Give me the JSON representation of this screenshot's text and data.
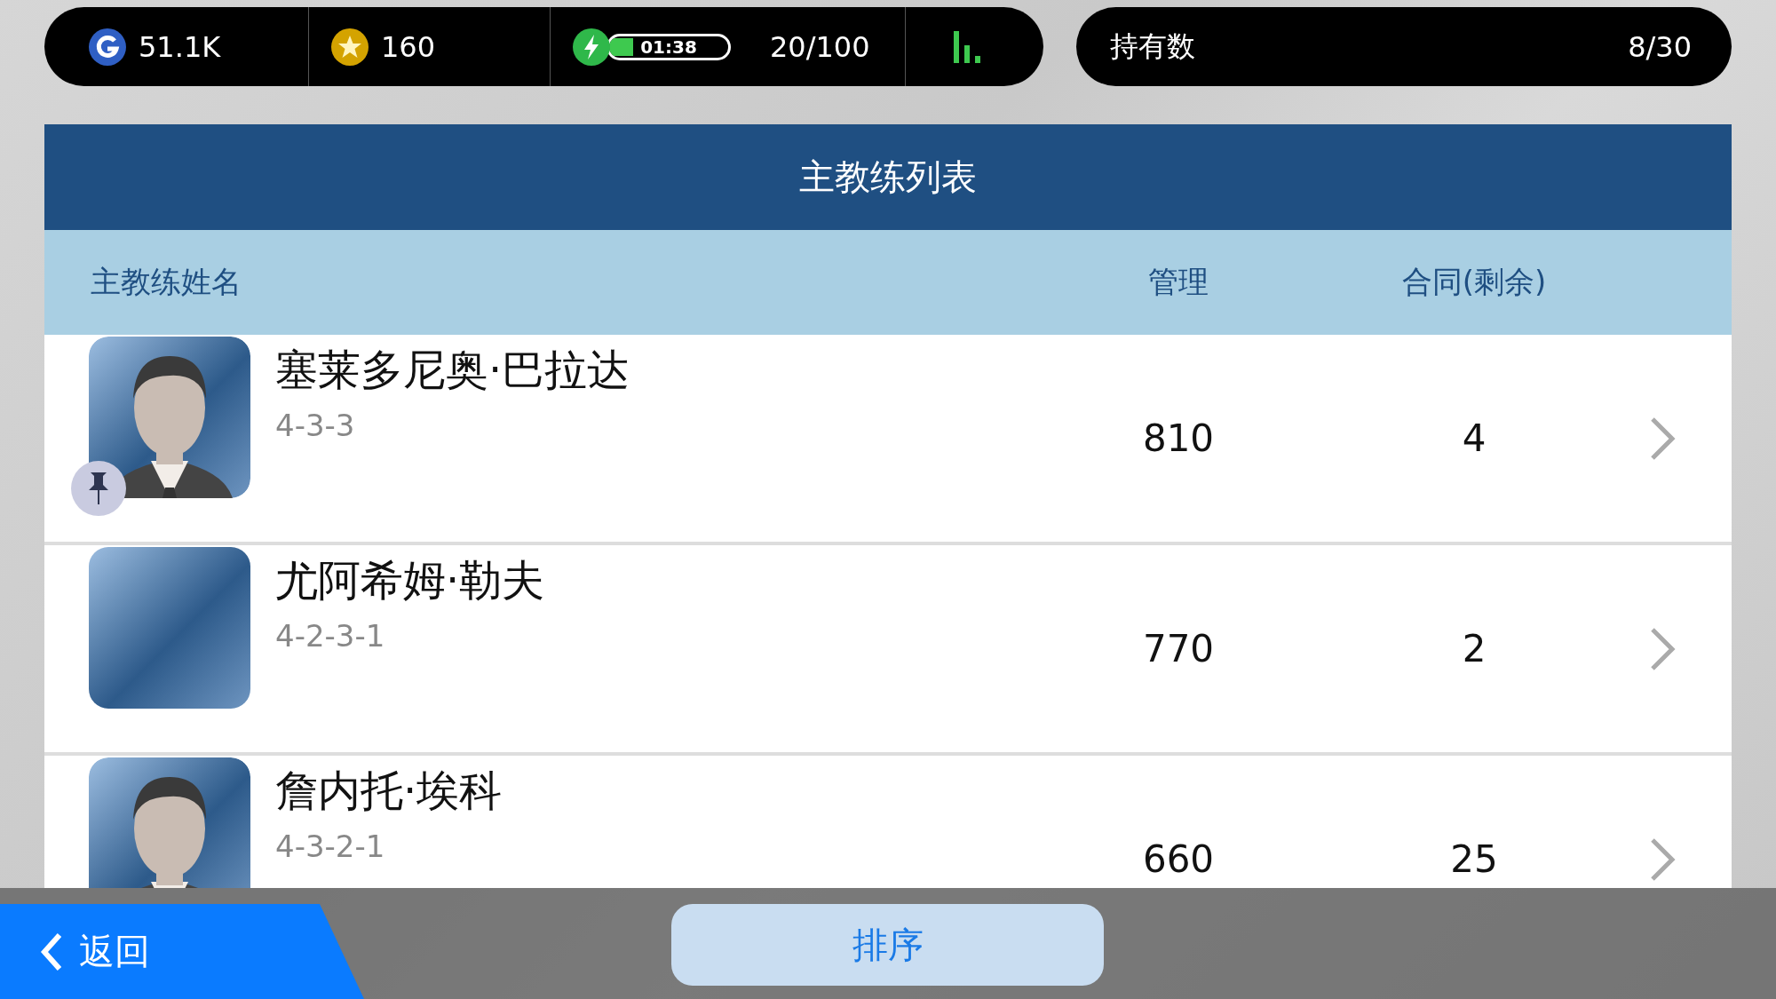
{
  "status_bar": {
    "gp": "51.1K",
    "coins": "160",
    "energy": {
      "timer": "01:38",
      "level": 0.2,
      "count": "20/100"
    }
  },
  "holdings": {
    "label": "持有数",
    "value": "8/30"
  },
  "panel": {
    "title": "主教练列表",
    "columns": [
      "主教练姓名",
      "管理",
      "合同(剩余)"
    ],
    "rows": [
      {
        "name": "塞莱多尼奥·巴拉达",
        "formation": "4-3-3",
        "management": "810",
        "contract": "4",
        "kind": "silhouette",
        "pinned": true
      },
      {
        "name": "尤阿希姆·勒夫",
        "formation": "4-2-3-1",
        "management": "770",
        "contract": "2",
        "kind": "photo",
        "pinned": false
      },
      {
        "name": "詹内托·埃科",
        "formation": "4-3-2-1",
        "management": "660",
        "contract": "25",
        "kind": "silhouette",
        "pinned": false
      }
    ]
  },
  "footer": {
    "back": "返回",
    "sort": "排序"
  }
}
